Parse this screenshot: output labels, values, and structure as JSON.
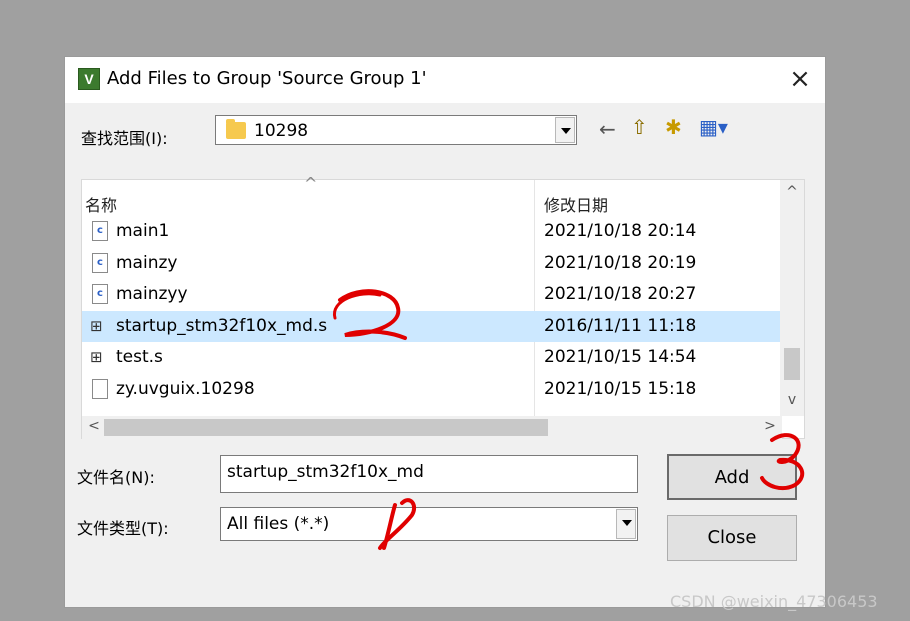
{
  "dialog": {
    "title": "Add Files to Group 'Source Group 1'",
    "title_icon_text": "V",
    "close_glyph": "×"
  },
  "lookin": {
    "label": "查找范围(I):",
    "value": "10298"
  },
  "toolbar": {
    "back_icon": "←",
    "up_icon": "⇧",
    "newfolder_icon": "✱",
    "view_icon": "▦▾"
  },
  "list": {
    "col_name": "名称",
    "col_date": "修改日期",
    "sort_glyph": "^",
    "rows": [
      {
        "name": "main1",
        "date": "2021/10/18 20:14",
        "kind": "c"
      },
      {
        "name": "mainzy",
        "date": "2021/10/18 20:19",
        "kind": "c"
      },
      {
        "name": "mainzyy",
        "date": "2021/10/18 20:27",
        "kind": "c"
      },
      {
        "name": "startup_stm32f10x_md.s",
        "date": "2016/11/11 11:18",
        "kind": "s"
      },
      {
        "name": "test.s",
        "date": "2021/10/15 14:54",
        "kind": "s"
      },
      {
        "name": "zy.uvguix.10298",
        "date": "2021/10/15 15:18",
        "kind": "f"
      }
    ],
    "scroll": {
      "up": "^",
      "down": "v",
      "left": "<",
      "right": ">"
    }
  },
  "filename": {
    "label": "文件名(N):",
    "value": "startup_stm32f10x_md"
  },
  "filetype": {
    "label": "文件类型(T):",
    "value": "All files (*.*)"
  },
  "buttons": {
    "add": "Add",
    "close": "Close"
  },
  "watermark": "CSDN @weixin_47306453",
  "colors": {
    "selection": "#cce8ff",
    "annotation": "#e00000"
  }
}
